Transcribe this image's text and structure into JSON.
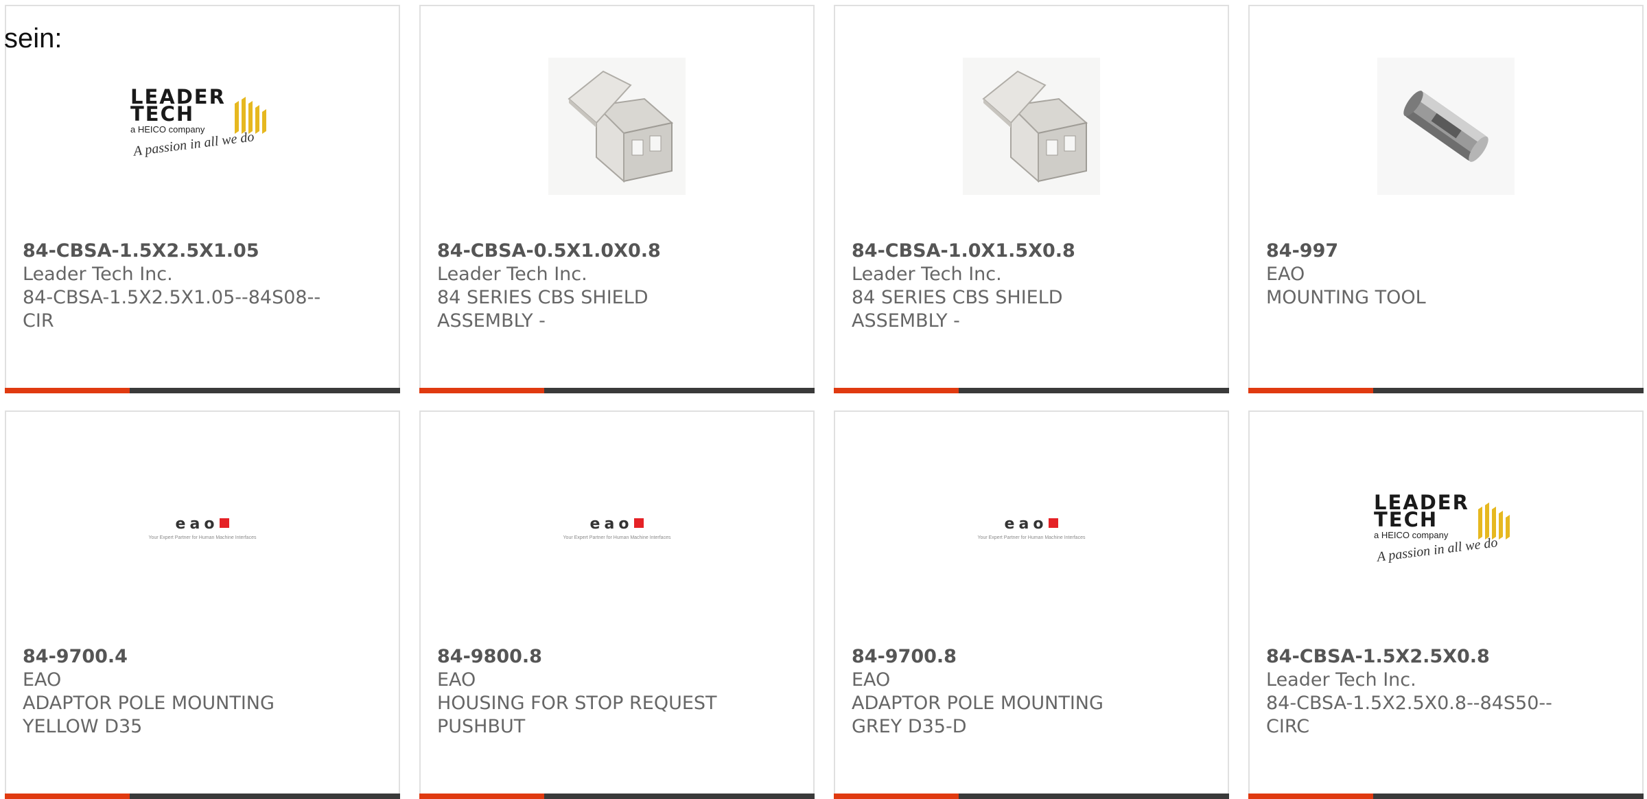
{
  "lead_text": "sein:",
  "colors": {
    "accent": "#e03a10",
    "bar": "#3a3a3a",
    "border": "#e0e0e0",
    "eao_red": "#e52226"
  },
  "logos": {
    "leader_tech": {
      "word": "LEADER\nTECH",
      "sub": "a HEICO company",
      "tagline": "A passion in all we do"
    },
    "eao": {
      "word": "eao",
      "sub": "Your Expert Partner for Human Machine Interfaces"
    }
  },
  "products": [
    {
      "part_number": "84-CBSA-1.5X2.5X1.05",
      "manufacturer": "Leader Tech Inc.",
      "description": "84-CBSA-1.5X2.5X1.05--84S08--\nCIR",
      "image": "leader-tech-logo"
    },
    {
      "part_number": "84-CBSA-0.5X1.0X0.8",
      "manufacturer": "Leader Tech Inc.",
      "description": "84 SERIES CBS SHIELD\nASSEMBLY -",
      "image": "shield-assembly-photo"
    },
    {
      "part_number": "84-CBSA-1.0X1.5X0.8",
      "manufacturer": "Leader Tech Inc.",
      "description": "84 SERIES CBS SHIELD\nASSEMBLY -",
      "image": "shield-assembly-photo"
    },
    {
      "part_number": "84-997",
      "manufacturer": "EAO",
      "description": "MOUNTING TOOL",
      "image": "mounting-tool-photo"
    },
    {
      "part_number": "84-9700.4",
      "manufacturer": "EAO",
      "description": "ADAPTOR POLE MOUNTING\nYELLOW D35",
      "image": "eao-logo"
    },
    {
      "part_number": "84-9800.8",
      "manufacturer": "EAO",
      "description": "HOUSING FOR STOP REQUEST\nPUSHBUT",
      "image": "eao-logo"
    },
    {
      "part_number": "84-9700.8",
      "manufacturer": "EAO",
      "description": "ADAPTOR POLE MOUNTING\nGREY D35-D",
      "image": "eao-logo"
    },
    {
      "part_number": "84-CBSA-1.5X2.5X0.8",
      "manufacturer": "Leader Tech Inc.",
      "description": "84-CBSA-1.5X2.5X0.8--84S50--\nCIRC",
      "image": "leader-tech-logo"
    }
  ]
}
